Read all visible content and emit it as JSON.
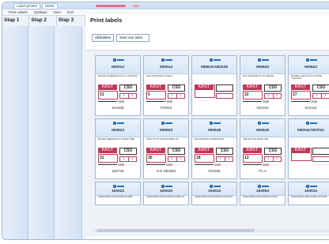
{
  "window": {
    "tabs": [
      "Label-printen",
      "Etiket"
    ],
    "menu": [
      "Print Labels",
      "Opslaan",
      "Over",
      "Exit"
    ]
  },
  "steps": [
    "Stap 1",
    "Stap 2",
    "Stap 3"
  ],
  "main": {
    "title": "Print labels",
    "toolbar": {
      "button": "Afdrukken",
      "field_value": "Start van label"
    }
  },
  "cards": [
    {
      "code": "060013",
      "desc": "BOUDE RUDERSVAL DAYC UNDPLEK",
      "num": "31",
      "foot": "642208",
      "kind": "full"
    },
    {
      "code": "060014",
      "desc": "HILLNOSTRADE LUNDAL",
      "num": "5",
      "foot": "070818",
      "kind": "full"
    },
    {
      "code": "080619.N92239",
      "desc": "",
      "num": "",
      "foot": "",
      "kind": "empty"
    },
    {
      "code": "090620",
      "desc": "DIN LEKLEGEN DYIO LEDOPL",
      "num": "22",
      "foot": "030103",
      "kind": "full"
    },
    {
      "code": "090622",
      "desc": "BOUDE LOSDYAL DYIF NUDR UNDPLEK",
      "num": "27",
      "foot": "022110",
      "kind": "full"
    },
    {
      "code": "090623",
      "desc": "BOUDE DEEDE DAYS NAUDO IMBL",
      "num": "31",
      "foot": "640728",
      "kind": "full"
    },
    {
      "code": "090629",
      "desc": "PODC DYOTYFANTPIJPIEF 407",
      "num": "30",
      "foot": "S.S-S92663",
      "kind": "full"
    },
    {
      "code": "090648",
      "desc": "BLOUDODRF DUNNIKRIJNS",
      "num": "18",
      "foot": "031658",
      "kind": "full"
    },
    {
      "code": "060649",
      "desc": "INPLAUS DE LEVEU 999",
      "num": "13",
      "foot": "PL.4",
      "kind": "full"
    },
    {
      "code": "090042.N07021",
      "desc": "",
      "num": "",
      "foot": "",
      "kind": "empty"
    },
    {
      "code": "100023",
      "desc": "PLESTER ELAND DUFRLAK 665F",
      "kind": "short"
    },
    {
      "code": "100026",
      "desc": "PLESTER ELAND SUPRLAK 5605 GA",
      "kind": "short"
    },
    {
      "code": "100015",
      "desc": "PLESTER ELAND DUFRLAK 6010 EA",
      "kind": "short"
    },
    {
      "code": "100053",
      "desc": "PLESTER ELAND DUFRLAK 6012",
      "kind": "short"
    },
    {
      "code": "100022",
      "desc": "PLESTER ELAND DUFRLAK 6703K",
      "kind": "short"
    }
  ],
  "label_text": {
    "kast": "KAST",
    "cso": "CSO",
    "stuk": "Stuk",
    "small": [
      "1",
      "1"
    ]
  },
  "colors": {
    "accent": "#c2385a",
    "brand": "#2a6fbd",
    "step_bg": "#d5e2f3"
  }
}
